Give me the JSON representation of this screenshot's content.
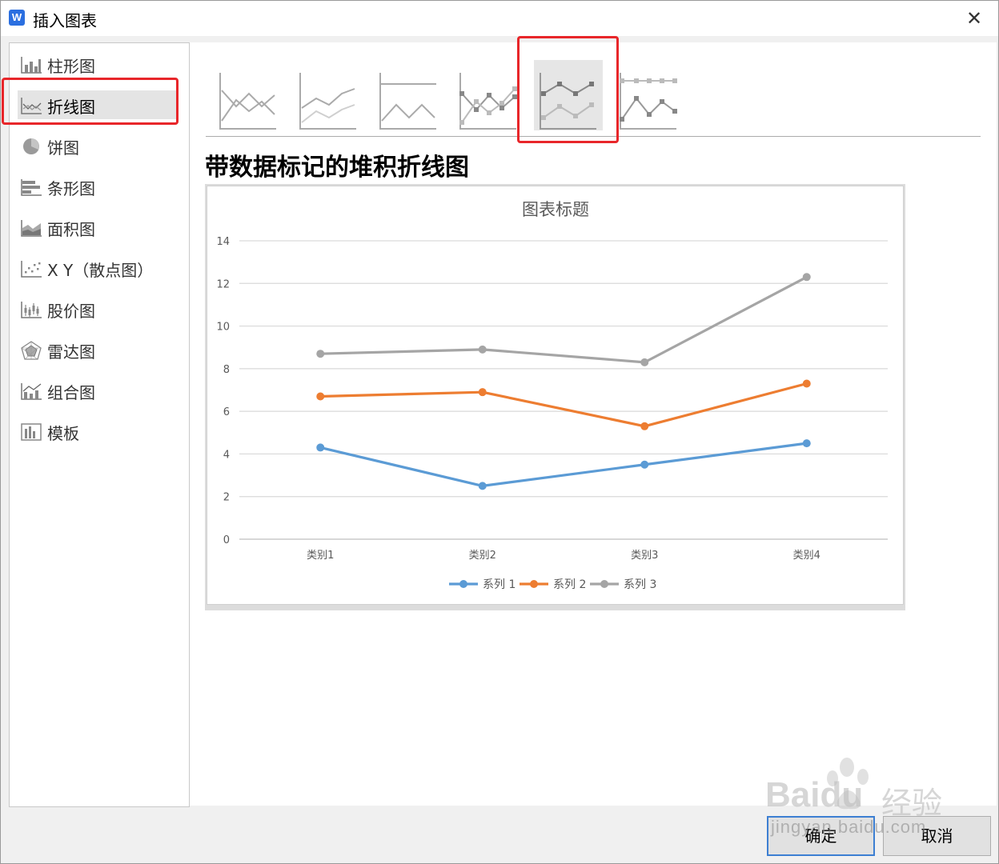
{
  "window": {
    "app_icon_letter": "W",
    "title": "插入图表",
    "close_symbol": "✕"
  },
  "sidebar": {
    "items": [
      {
        "label": "柱形图",
        "icon": "column-chart-icon"
      },
      {
        "label": "折线图",
        "icon": "line-chart-icon",
        "active": true
      },
      {
        "label": "饼图",
        "icon": "pie-chart-icon"
      },
      {
        "label": "条形图",
        "icon": "bar-chart-icon"
      },
      {
        "label": "面积图",
        "icon": "area-chart-icon"
      },
      {
        "label": "X Y（散点图）",
        "icon": "scatter-chart-icon"
      },
      {
        "label": "股价图",
        "icon": "stock-chart-icon"
      },
      {
        "label": "雷达图",
        "icon": "radar-chart-icon"
      },
      {
        "label": "组合图",
        "icon": "combo-chart-icon"
      },
      {
        "label": "模板",
        "icon": "template-icon"
      }
    ]
  },
  "subtypes": [
    {
      "icon": "line-chart-thumb-icon"
    },
    {
      "icon": "stacked-line-thumb-icon"
    },
    {
      "icon": "percent-stacked-line-thumb-icon"
    },
    {
      "icon": "line-with-markers-thumb-icon"
    },
    {
      "icon": "stacked-line-with-markers-thumb-icon",
      "selected": true
    },
    {
      "icon": "percent-stacked-line-with-markers-thumb-icon"
    }
  ],
  "selected_type_heading": "带数据标记的堆积折线图",
  "chart_data": {
    "type": "line",
    "title": "图表标题",
    "categories": [
      "类别1",
      "类别2",
      "类别3",
      "类别4"
    ],
    "series": [
      {
        "name": "系列 1",
        "values": [
          4.3,
          2.5,
          3.5,
          4.5
        ],
        "color": "#5b9bd5"
      },
      {
        "name": "系列 2",
        "values": [
          6.7,
          6.9,
          5.3,
          7.3
        ],
        "color": "#ed7d31"
      },
      {
        "name": "系列 3",
        "values": [
          8.7,
          8.9,
          8.3,
          12.3
        ],
        "color": "#a5a5a5"
      }
    ],
    "yticks": [
      "0",
      "2",
      "4",
      "6",
      "8",
      "10",
      "12",
      "14"
    ],
    "ylim": [
      0,
      14
    ],
    "grid": true,
    "legend": "bottom"
  },
  "footer": {
    "ok_label": "确定",
    "cancel_label": "取消"
  },
  "watermark": {
    "brand": "Baidu",
    "brand_suffix": "经验",
    "url": "jingyan.baidu.com"
  },
  "colors": {
    "highlight_red": "#e8262a",
    "accent_blue": "#3d7fd2"
  }
}
